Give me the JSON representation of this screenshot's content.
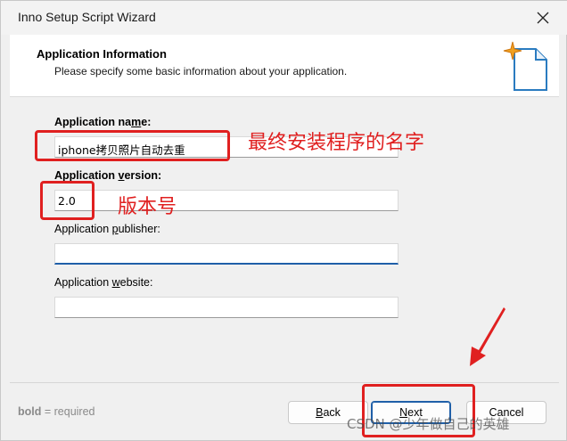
{
  "window": {
    "title": "Inno Setup Script Wizard"
  },
  "header": {
    "title": "Application Information",
    "subtitle": "Please specify some basic information about your application."
  },
  "form": {
    "name_label_pre": "Application na",
    "name_label_u": "m",
    "name_label_post": "e:",
    "name_value": "iphone拷贝照片自动去重",
    "version_label_pre": "Application ",
    "version_label_u": "v",
    "version_label_post": "ersion:",
    "version_value": "2.0",
    "publisher_label_pre": "Application ",
    "publisher_label_u": "p",
    "publisher_label_post": "ublisher:",
    "publisher_value": "",
    "website_label_pre": "Application ",
    "website_label_u": "w",
    "website_label_post": "ebsite:",
    "website_value": ""
  },
  "annotations": {
    "name_note": "最终安装程序的名字",
    "version_note": "版本号"
  },
  "footer": {
    "hint_bold": "bold",
    "hint_rest": " = required",
    "back_u": "B",
    "back_rest": "ack",
    "next_u": "N",
    "next_rest": "ext",
    "cancel_label": "Cancel"
  },
  "watermark": "CSDN @少年做自己的英雄",
  "colors": {
    "annotation": "#e02020",
    "focus": "#1f5fa8"
  }
}
